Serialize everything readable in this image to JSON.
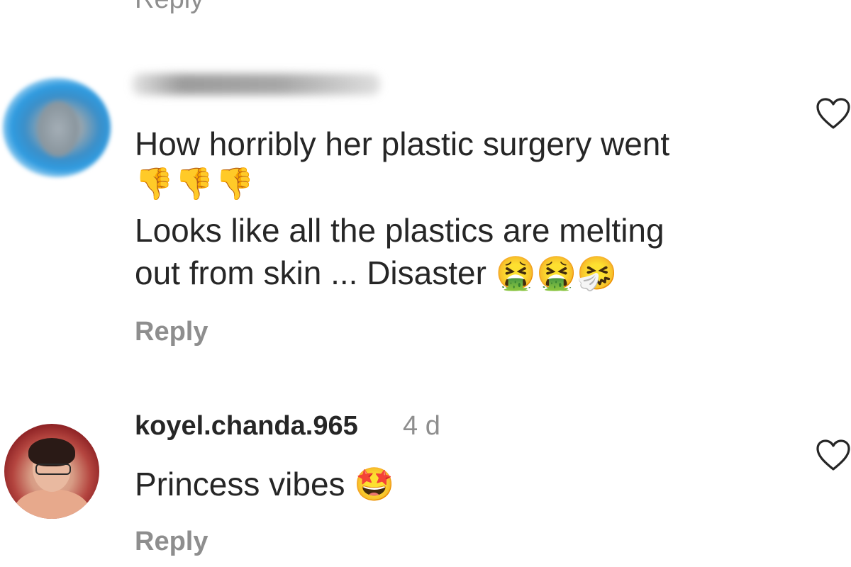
{
  "comments": [
    {
      "username": "",
      "line1": "How horribly her plastic surgery went",
      "emoji_row": "👎👎👎",
      "line2": "Looks like all the plastics are melting",
      "line3": "out from skin ... Disaster 🤮🤮🤧",
      "reply_label": "Reply",
      "like_icon": "heart-outline-icon"
    },
    {
      "username": "koyel.chanda.965",
      "time": "4 d",
      "text": "Princess vibes 🤩",
      "reply_label": "Reply",
      "like_icon": "heart-outline-icon"
    }
  ]
}
